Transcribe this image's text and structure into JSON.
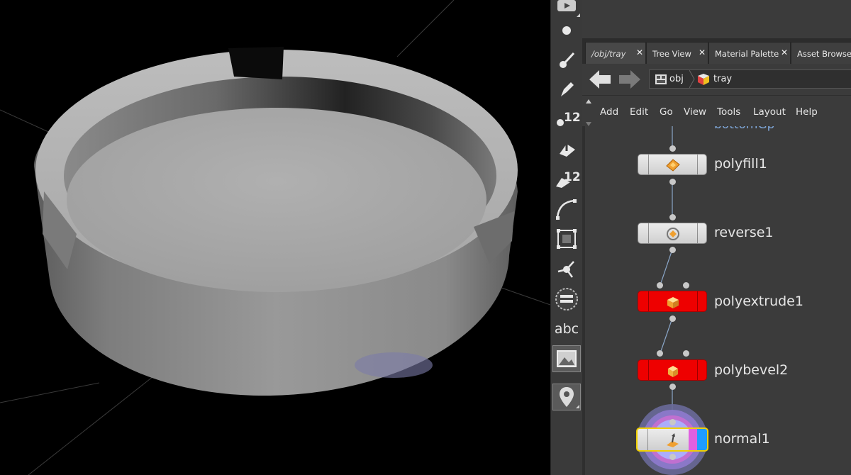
{
  "tabs": [
    {
      "label": "/obj/tray",
      "active": true
    },
    {
      "label": "Tree View",
      "active": false
    },
    {
      "label": "Material Palette",
      "active": false
    },
    {
      "label": "Asset Browser",
      "active": false
    }
  ],
  "path": {
    "root": "obj",
    "current": "tray"
  },
  "menu": [
    "Add",
    "Edit",
    "Go",
    "View",
    "Tools",
    "Layout",
    "Help"
  ],
  "network": {
    "partial_label": "bottomGp",
    "nodes": [
      {
        "name": "polyfill1",
        "color": "#dcdcdc",
        "icon": "polyfill-icon"
      },
      {
        "name": "reverse1",
        "color": "#dcdcdc",
        "icon": "reverse-icon"
      },
      {
        "name": "polyextrude1",
        "color": "#ee0000",
        "icon": "polyextrude-icon"
      },
      {
        "name": "polybevel2",
        "color": "#ee0000",
        "icon": "polybevel-icon"
      },
      {
        "name": "normal1",
        "color": "#dcdcdc",
        "icon": "normal-icon",
        "selected": true,
        "display_flag": "#e060e0",
        "render_flag": "#1e9cff"
      }
    ]
  },
  "toolbar": {
    "items": [
      {
        "icon": "view-icon"
      },
      {
        "icon": "point-icon"
      },
      {
        "icon": "brush-icon"
      },
      {
        "icon": "pen-icon"
      },
      {
        "icon": "point-numbers-icon",
        "text": "12"
      },
      {
        "icon": "primitive-icon"
      },
      {
        "icon": "primitive-numbers-icon",
        "text": "12"
      },
      {
        "icon": "curve-icon"
      },
      {
        "icon": "checker-icon"
      },
      {
        "icon": "handle-icon"
      },
      {
        "icon": "wireframe-icon"
      },
      {
        "icon": "text-icon",
        "text": "abc"
      },
      {
        "icon": "background-image-icon"
      },
      {
        "icon": "location-pin-icon"
      }
    ]
  },
  "colors": {
    "viewport_bg": "#000000",
    "panel_bg": "#3b3b3b",
    "breadcrumb_partial": "#7fa7d9"
  }
}
